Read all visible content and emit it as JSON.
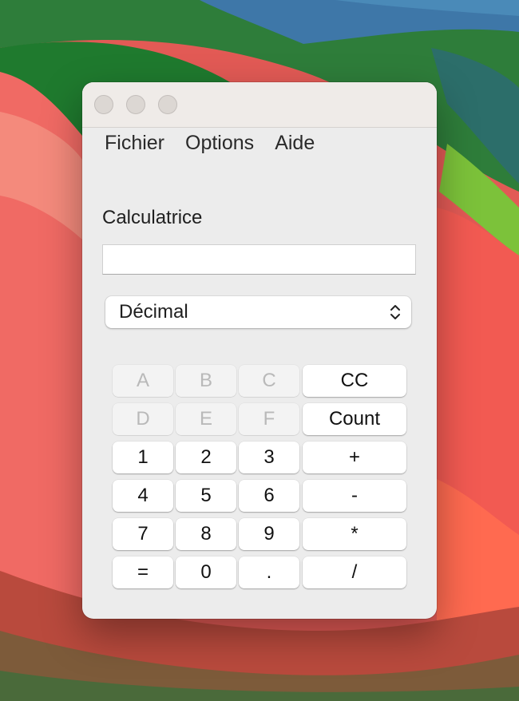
{
  "window": {
    "menu": [
      "Fichier",
      "Options",
      "Aide"
    ]
  },
  "app": {
    "label": "Calculatrice",
    "display_value": "",
    "mode_select": {
      "selected": "Décimal",
      "icon": "chevrons-up-down-icon"
    }
  },
  "keys": {
    "row1": [
      "A",
      "B",
      "C",
      "CC"
    ],
    "row2": [
      "D",
      "E",
      "F",
      "Count"
    ],
    "row3": [
      "1",
      "2",
      "3",
      "+"
    ],
    "row4": [
      "4",
      "5",
      "6",
      "-"
    ],
    "row5": [
      "7",
      "8",
      "9",
      "*"
    ],
    "row6": [
      "=",
      "0",
      ".",
      "/"
    ],
    "disabled": [
      "A",
      "B",
      "C",
      "D",
      "E",
      "F"
    ]
  },
  "colors": {
    "window_bg": "#ececec",
    "titlebar_bg": "#efebe8",
    "disabled_key_text": "#b9b9b9"
  }
}
